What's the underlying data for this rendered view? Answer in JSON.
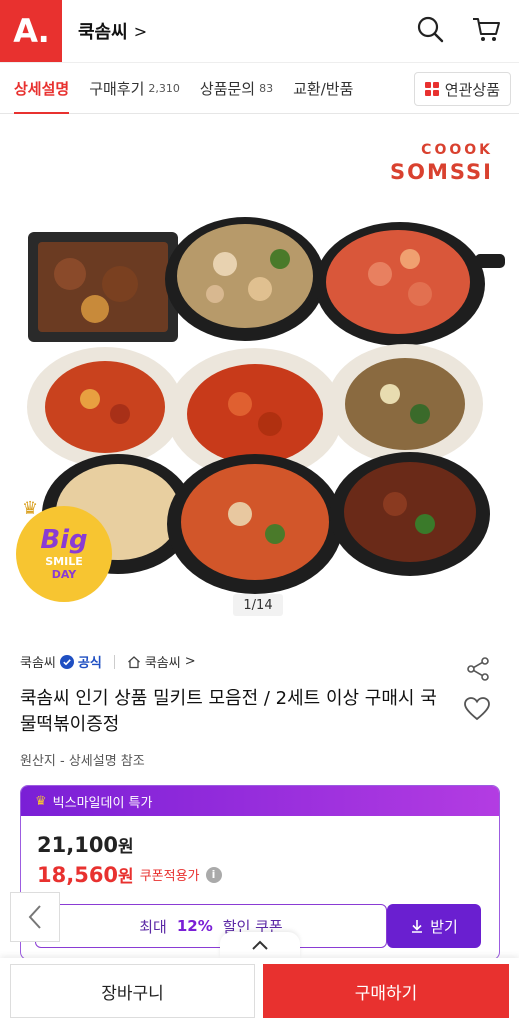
{
  "header": {
    "logo_text": "A.",
    "store_name": "쿡솜씨",
    "chevron": ">",
    "icons": [
      "search-icon",
      "cart-icon"
    ]
  },
  "tabs": [
    {
      "label": "상세설명",
      "count": "",
      "active": true
    },
    {
      "label": "구매후기",
      "count": "2,310",
      "active": false
    },
    {
      "label": "상품문의",
      "count": "83",
      "active": false
    },
    {
      "label": "교환/반품",
      "count": "",
      "active": false
    }
  ],
  "related_tab": {
    "label": "연관상품"
  },
  "hero": {
    "brand_top": "COOOK",
    "brand_bottom": "SOMSSI",
    "pager": "1/14",
    "badge_big": "Big",
    "badge_smile": "SMILE",
    "badge_day": "DAY"
  },
  "seller": {
    "name": "쿡솜씨",
    "official": "공식",
    "store_link": "쿡솜씨",
    "store_chevron": ">"
  },
  "product": {
    "title": "쿡솜씨 인기 상품 밀키트 모음전 / 2세트 이상 구매시 국물떡볶이증정",
    "origin": "원산지 - 상세설명 참조"
  },
  "promo": {
    "header": "빅스마일데이 특가",
    "original_price": "21,100",
    "original_unit": "원",
    "sale_price": "18,560",
    "sale_unit": "원",
    "sale_note": "쿠폰적용가",
    "coupon_prefix": "최대",
    "coupon_percent": "12%",
    "coupon_suffix": "할인 쿠폰",
    "receive_label": "받기"
  },
  "bottom_bar": {
    "cart_label": "장바구니",
    "buy_label": "구매하기"
  },
  "colors": {
    "brand_red": "#e8312f",
    "promo_purple": "#7a1fd6",
    "official_blue": "#1f4fc2"
  }
}
